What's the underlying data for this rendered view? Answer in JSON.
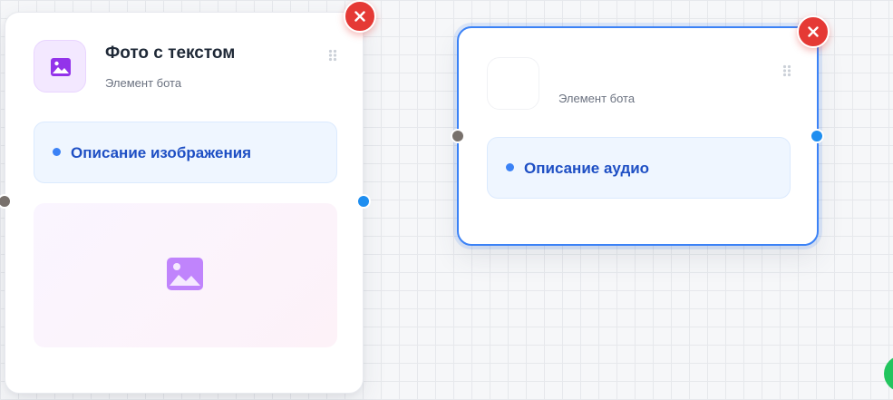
{
  "nodes": {
    "photo": {
      "title": "Фото с текстом",
      "subtitle": "Элемент бота",
      "field": "Описание изображения",
      "icon": "image-icon",
      "accent": "#9333ea"
    },
    "audio": {
      "title": "",
      "subtitle": "Элемент бота",
      "field": "Описание аудио",
      "icon": "audio-icon",
      "selected": true,
      "accent": "#3b82f6"
    }
  },
  "colors": {
    "delete": "#e53935",
    "port_in": "#78716c",
    "port_out": "#1e8ef0",
    "field_text": "#1e4fc4",
    "selection": "#3b82f6"
  }
}
